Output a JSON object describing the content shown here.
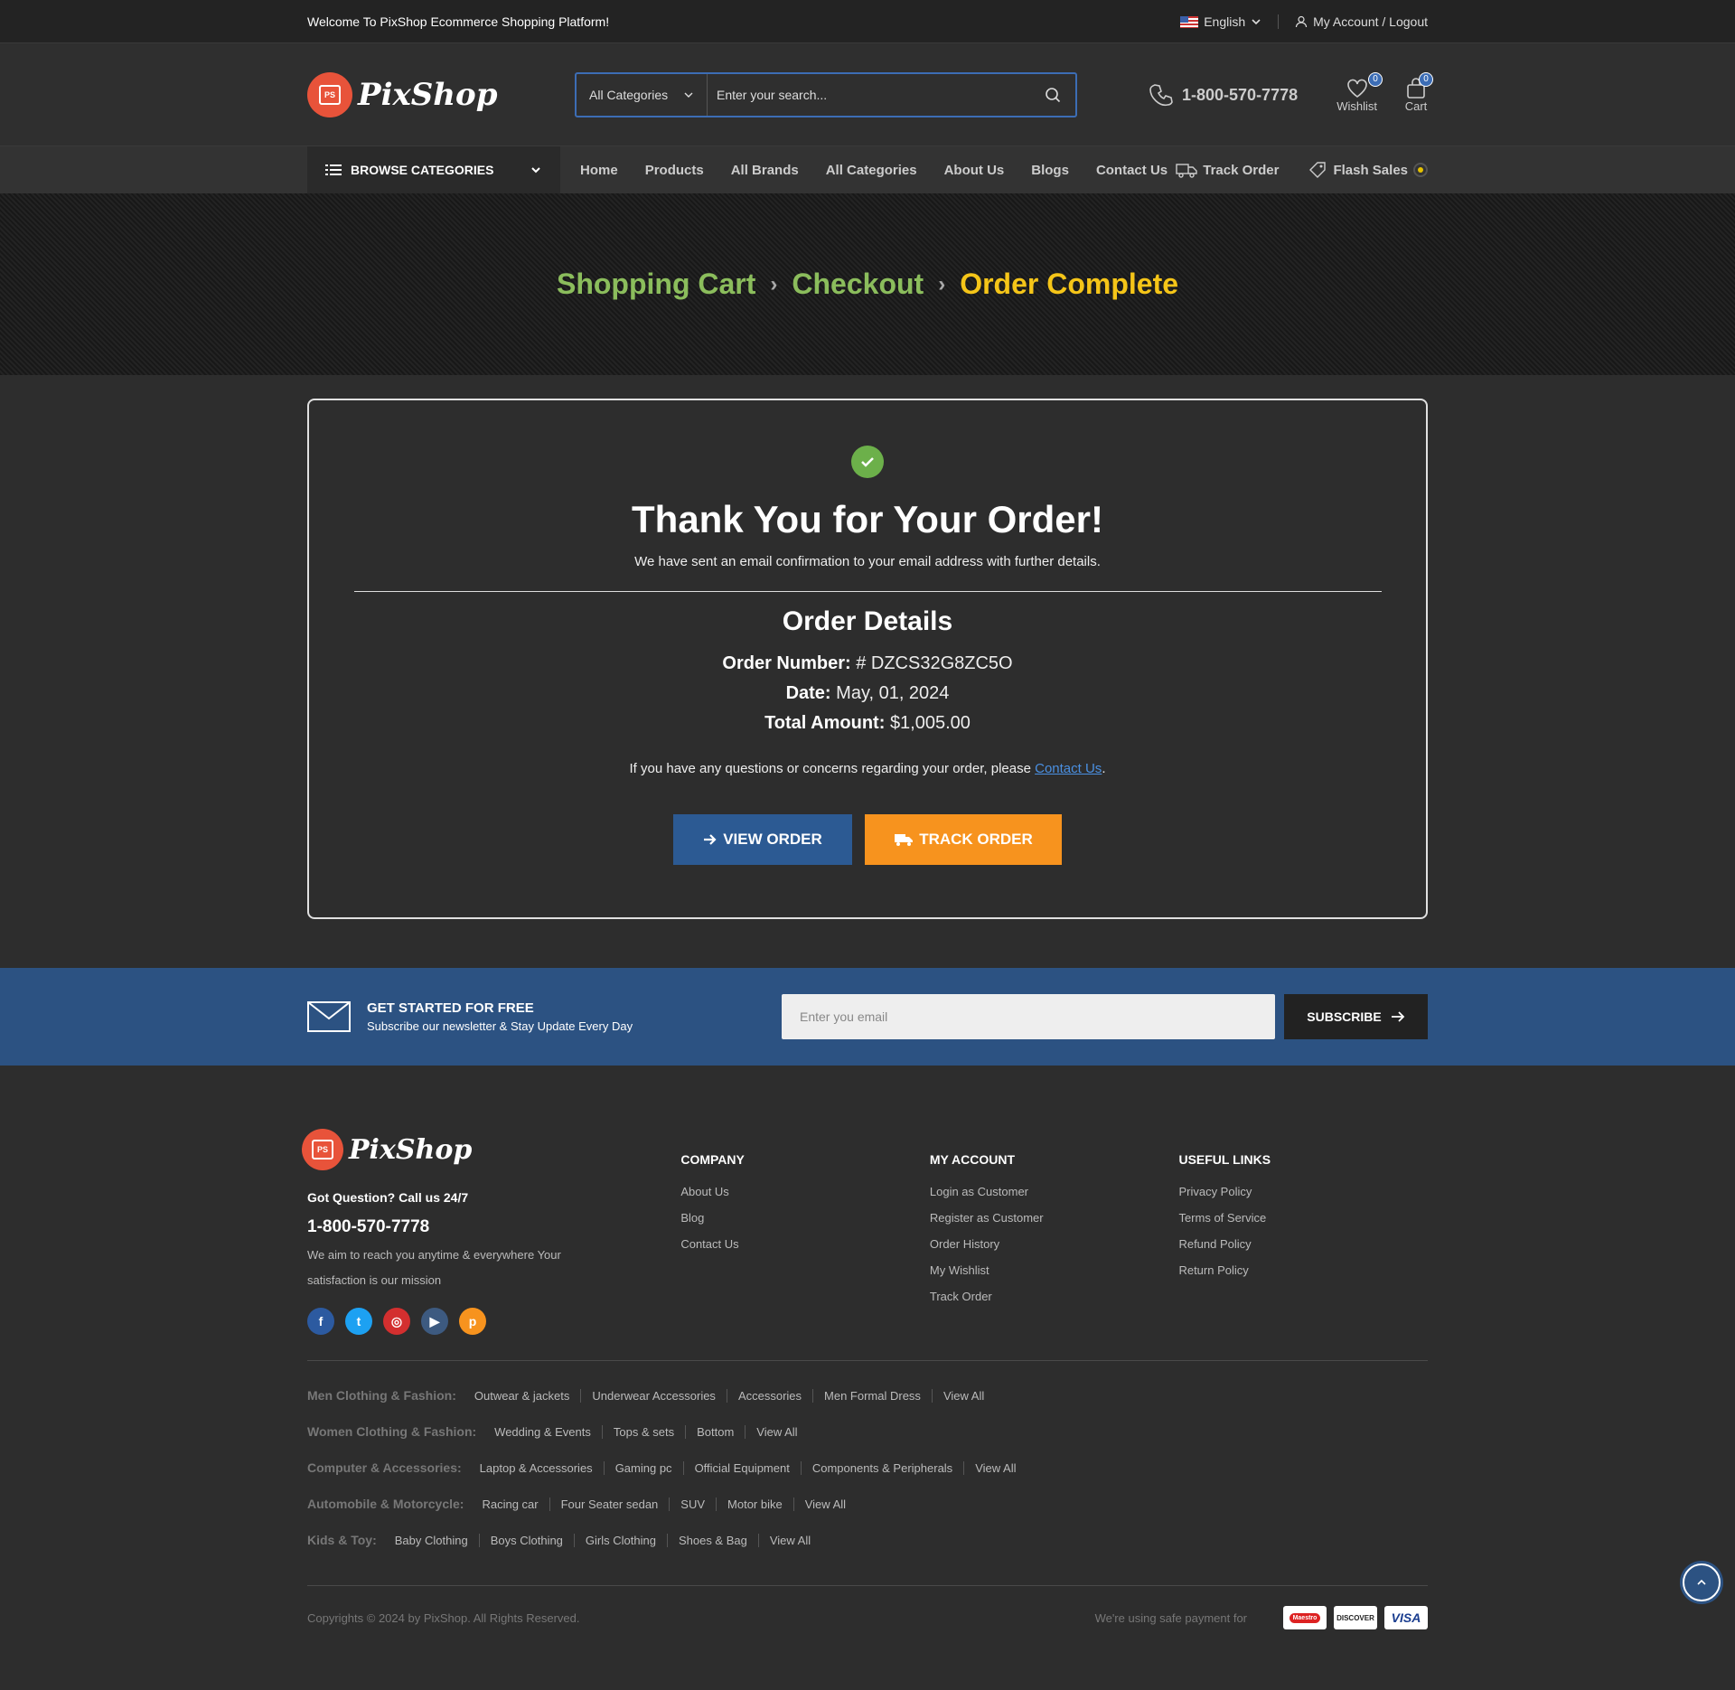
{
  "topbar": {
    "welcome": "Welcome To PixShop Ecommerce Shopping Platform!",
    "language": "English",
    "account": "My Account / Logout"
  },
  "header": {
    "logo": "PixShop",
    "search_category": "All Categories",
    "search_placeholder": "Enter your search...",
    "phone": "1-800-570-7778",
    "wishlist_label": "Wishlist",
    "wishlist_count": "0",
    "cart_label": "Cart",
    "cart_count": "0"
  },
  "nav": {
    "browse": "BROWSE CATEGORIES",
    "links": [
      "Home",
      "Products",
      "All Brands",
      "All Categories",
      "About Us",
      "Blogs",
      "Contact Us"
    ],
    "track_order": "Track Order",
    "flash_sales": "Flash Sales"
  },
  "hero": {
    "steps": [
      "Shopping Cart",
      "Checkout",
      "Order Complete"
    ]
  },
  "order": {
    "title": "Thank You for Your Order!",
    "subtitle": "We have sent an email confirmation to your email address with further details.",
    "details_title": "Order Details",
    "number_label": "Order Number:",
    "number_value": "# DZCS32G8ZC5O",
    "date_label": "Date:",
    "date_value": "May, 01, 2024",
    "total_label": "Total Amount:",
    "total_value": "$1,005.00",
    "question_text": "If you have any questions or concerns regarding your order, please",
    "contact_link": "Contact Us",
    "view_button": "VIEW ORDER",
    "track_button": "TRACK ORDER"
  },
  "newsletter": {
    "title": "GET STARTED FOR FREE",
    "subtitle": "Subscribe our newsletter & Stay Update Every Day",
    "placeholder": "Enter you email",
    "button": "SUBSCRIBE"
  },
  "footer": {
    "logo": "PixShop",
    "question": "Got Question? Call us 24/7",
    "phone": "1-800-570-7778",
    "aim": "We aim to reach you anytime & everywhere Your satisfaction is our mission",
    "company_title": "COMPANY",
    "company": [
      "About Us",
      "Blog",
      "Contact Us"
    ],
    "account_title": "MY ACCOUNT",
    "account": [
      "Login as Customer",
      "Register as Customer",
      "Order History",
      "My Wishlist",
      "Track Order"
    ],
    "useful_title": "USEFUL LINKS",
    "useful": [
      "Privacy Policy",
      "Terms of Service",
      "Refund Policy",
      "Return Policy"
    ],
    "categories": [
      {
        "label": "Men Clothing & Fashion:",
        "links": [
          "Outwear & jackets",
          "Underwear Accessories",
          "Accessories",
          "Men Formal Dress",
          "View All"
        ]
      },
      {
        "label": "Women Clothing & Fashion:",
        "links": [
          "Wedding & Events",
          "Tops & sets",
          "Bottom",
          "View All"
        ]
      },
      {
        "label": "Computer & Accessories:",
        "links": [
          "Laptop & Accessories",
          "Gaming pc",
          "Official Equipment",
          "Components & Peripherals",
          "View All"
        ]
      },
      {
        "label": "Automobile & Motorcycle:",
        "links": [
          "Racing car",
          "Four Seater sedan",
          "SUV",
          "Motor bike",
          "View All"
        ]
      },
      {
        "label": "Kids & Toy:",
        "links": [
          "Baby Clothing",
          "Boys Clothing",
          "Girls Clothing",
          "Shoes & Bag",
          "View All"
        ]
      }
    ],
    "copyright": "Copyrights © 2024 by PixShop. All Rights Reserved.",
    "payment_note": "We're using safe payment for",
    "payments": [
      "Maestro",
      "DISCOVER",
      "VISA"
    ]
  },
  "colors": {
    "accent_blue": "#2c5282",
    "accent_orange": "#f7931e",
    "crumb_done": "#8bbd5c",
    "crumb_current": "#f5c518",
    "success_green": "#6cb04a"
  }
}
